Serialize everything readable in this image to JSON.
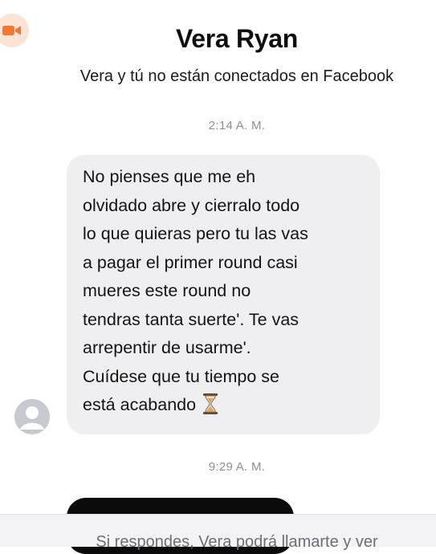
{
  "header": {
    "name": "Vera Ryan",
    "subtitle": "Vera y tú no están conectados en Facebook"
  },
  "conversation": {
    "timestamps": [
      "2:14 A. M.",
      "9:29 A. M."
    ],
    "incoming_message": {
      "lines": [
        "No pienses que me eh",
        "olvidado abre y cierralo todo",
        "lo que quieras pero tu las vas",
        "a pagar el primer round casi",
        "mueres este round no",
        "tendras tanta suerte'. Te vas",
        "arrepentir de usarme'.",
        "Cuídese que tu tiempo se",
        "está acabando"
      ],
      "trailing_emoji": "hourglass-icon"
    }
  },
  "footer": {
    "notice": "Si respondes, Vera podrá llamarte y ver"
  },
  "icons": {
    "video_call": "video-camera-icon",
    "avatar": "default-profile-avatar"
  },
  "colors": {
    "accent": "#f4772e",
    "bubble_incoming": "#efeff2",
    "timestamp": "#8e8e93"
  }
}
